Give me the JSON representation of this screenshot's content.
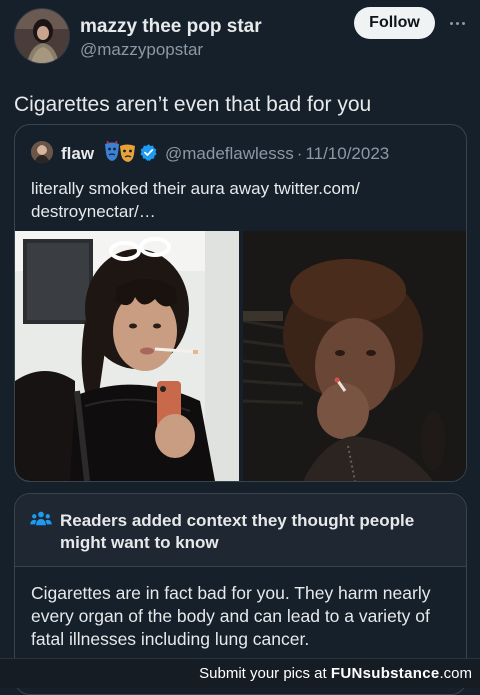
{
  "post": {
    "display_name": "mazzy thee pop star",
    "handle": "@mazzypopstar",
    "follow_label": "Follow",
    "text": "Cigarettes aren’t even that bad for you"
  },
  "quote": {
    "display_name": "flaw",
    "handle": "@madeflawlesss",
    "separator": "·",
    "date": "11/10/2023",
    "text": "literally smoked their aura away twitter.com/\ndestroynectar/…"
  },
  "context_note": {
    "title": "Readers added context they thought people might want to know",
    "body": "Cigarettes are in fact bad for you. They harm nearly every organ of the body and can lead to a variety of fatal illnesses including lung cancer."
  },
  "footer": {
    "prefix": "Submit your pics at ",
    "brand": "FUNsubstance",
    "suffix": ".com"
  },
  "icons": {
    "verified": "verified-badge-icon",
    "mask": "theater-mask-icon",
    "people": "people-icon",
    "more": "more-horizontal-icon"
  },
  "colors": {
    "background": "#15202b",
    "accent": "#1d9bf0",
    "muted_text": "#8b98a5",
    "note_header": "#1e2732"
  }
}
